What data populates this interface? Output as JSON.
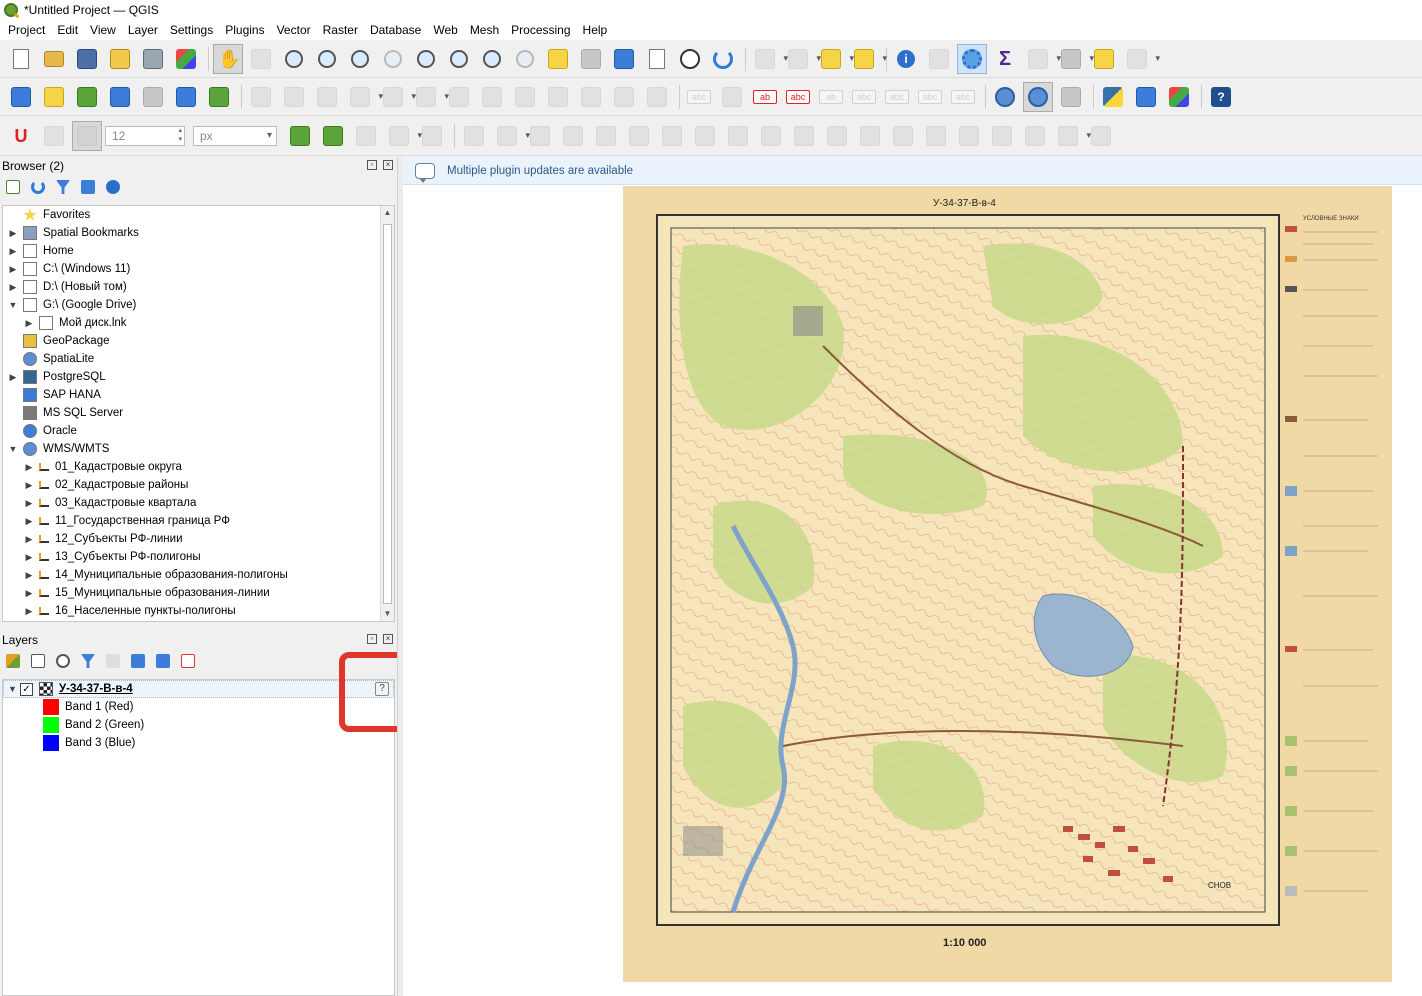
{
  "window": {
    "title": "*Untitled Project — QGIS"
  },
  "menu": [
    "Project",
    "Edit",
    "View",
    "Layer",
    "Settings",
    "Plugins",
    "Vector",
    "Raster",
    "Database",
    "Web",
    "Mesh",
    "Processing",
    "Help"
  ],
  "digitizing": {
    "size_value": "12",
    "unit_value": "px"
  },
  "browser": {
    "title": "Browser (2)",
    "items": [
      {
        "label": "Favorites",
        "icon": "star-icon",
        "expand": false,
        "indent": 0
      },
      {
        "label": "Spatial Bookmarks",
        "icon": "bookmark-icon",
        "expand": true,
        "indent": 0
      },
      {
        "label": "Home",
        "icon": "home-icon",
        "expand": true,
        "indent": 0
      },
      {
        "label": "C:\\ (Windows 11)",
        "icon": "drive-icon",
        "expand": true,
        "indent": 0
      },
      {
        "label": "D:\\ (Новый том)",
        "icon": "drive-icon",
        "expand": true,
        "indent": 0
      },
      {
        "label": "G:\\ (Google Drive)",
        "icon": "drive-icon",
        "expand": "open",
        "indent": 0
      },
      {
        "label": "Мой диск.lnk",
        "icon": "shortcut-icon",
        "expand": true,
        "indent": 1
      },
      {
        "label": "GeoPackage",
        "icon": "geopackage-icon",
        "expand": false,
        "indent": 0
      },
      {
        "label": "SpatiaLite",
        "icon": "spatialite-icon",
        "expand": false,
        "indent": 0
      },
      {
        "label": "PostgreSQL",
        "icon": "postgresql-icon",
        "expand": true,
        "indent": 0
      },
      {
        "label": "SAP HANA",
        "icon": "sap-hana-icon",
        "expand": false,
        "indent": 0
      },
      {
        "label": "MS SQL Server",
        "icon": "mssql-icon",
        "expand": false,
        "indent": 0
      },
      {
        "label": "Oracle",
        "icon": "oracle-icon",
        "expand": false,
        "indent": 0
      },
      {
        "label": "WMS/WMTS",
        "icon": "wms-icon",
        "expand": "open",
        "indent": 0
      },
      {
        "label": "01_Кадастровые округа",
        "icon": "wms-layer-icon",
        "expand": true,
        "indent": 1
      },
      {
        "label": "02_Кадастровые районы",
        "icon": "wms-layer-icon",
        "expand": true,
        "indent": 1
      },
      {
        "label": "03_Кадастровые квартала",
        "icon": "wms-layer-icon",
        "expand": true,
        "indent": 1
      },
      {
        "label": "11_Государственная граница РФ",
        "icon": "wms-layer-icon",
        "expand": true,
        "indent": 1
      },
      {
        "label": "12_Субъекты РФ-линии",
        "icon": "wms-layer-icon",
        "expand": true,
        "indent": 1
      },
      {
        "label": "13_Субъекты РФ-полигоны",
        "icon": "wms-layer-icon",
        "expand": true,
        "indent": 1
      },
      {
        "label": "14_Муниципальные образования-полигоны",
        "icon": "wms-layer-icon",
        "expand": true,
        "indent": 1
      },
      {
        "label": "15_Муниципальные образования-линии",
        "icon": "wms-layer-icon",
        "expand": true,
        "indent": 1
      },
      {
        "label": "16_Населенные пункты-полигоны",
        "icon": "wms-layer-icon",
        "expand": true,
        "indent": 1
      }
    ]
  },
  "layers": {
    "title": "Layers",
    "layer_name": "У-34-37-В-в-4",
    "warning_glyph": "?",
    "bands": [
      {
        "label": "Band 1 (Red)",
        "color": "#ff0000"
      },
      {
        "label": "Band 2 (Green)",
        "color": "#00ff00"
      },
      {
        "label": "Band 3 (Blue)",
        "color": "#0000ff"
      }
    ]
  },
  "map": {
    "message": "Multiple plugin updates are available",
    "sheet_label": "У-34-37-В-в-4",
    "scale_text": "1:10 000",
    "legend_title": "УСЛОВНЫЕ ЗНАКИ",
    "town_label": "СНОВ"
  },
  "colors": {
    "accent": "#2b5a8a",
    "highlight_box": "#e0352b",
    "map_paper": "#f1d9a6",
    "map_green": "#c8d98a",
    "map_water": "#9bb5cf",
    "map_contour": "#d9886a"
  }
}
